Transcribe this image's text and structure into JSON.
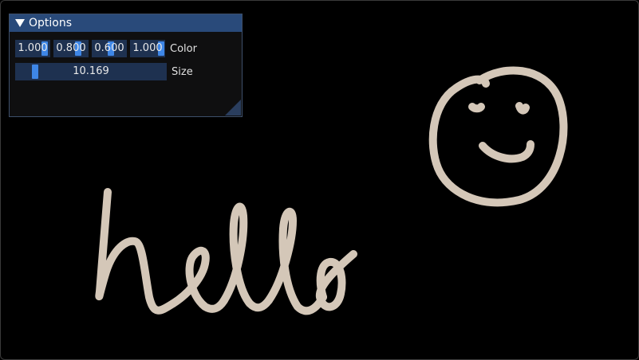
{
  "panel": {
    "title": "Options",
    "color_label": "Color",
    "size_label": "Size",
    "color_values": [
      "1.000",
      "0.800",
      "0.600",
      "1.000"
    ],
    "size_value": "10.169"
  },
  "brush": {
    "stroke_color": "#d4c7b8",
    "accent_color": "#3e86e6"
  }
}
